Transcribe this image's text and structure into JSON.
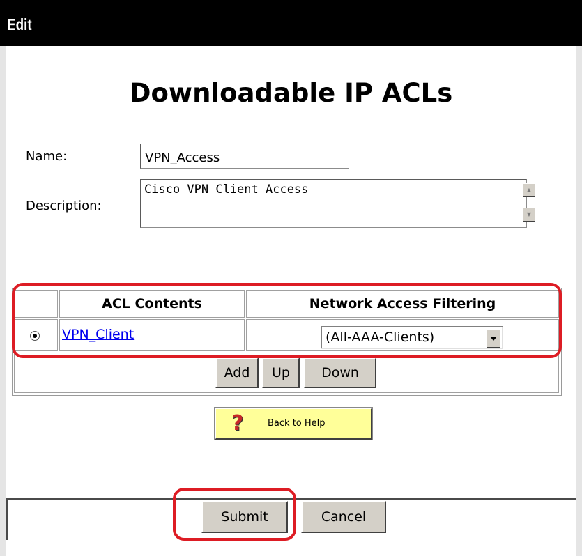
{
  "window": {
    "title": "Edit"
  },
  "page": {
    "heading": "Downloadable IP ACLs"
  },
  "form": {
    "name_label": "Name:",
    "name_value": "VPN_Access",
    "description_label": "Description:",
    "description_value": "Cisco VPN Client Access"
  },
  "acl_table": {
    "headers": [
      "ACL Contents",
      "Network Access Filtering"
    ],
    "rows": [
      {
        "selected": true,
        "acl_name": "VPN_Client",
        "filtering": "(All-AAA-Clients)"
      }
    ],
    "buttons": {
      "add": "Add",
      "up": "Up",
      "down": "Down"
    }
  },
  "help": {
    "label": "Back to Help",
    "icon": "question-mark-icon"
  },
  "footer": {
    "submit_label": "Submit",
    "cancel_label": "Cancel"
  },
  "colors": {
    "highlight": "#dd1c24",
    "link": "#0000ee",
    "help_button": "#ffff99",
    "button_face": "#d4d0c8"
  }
}
